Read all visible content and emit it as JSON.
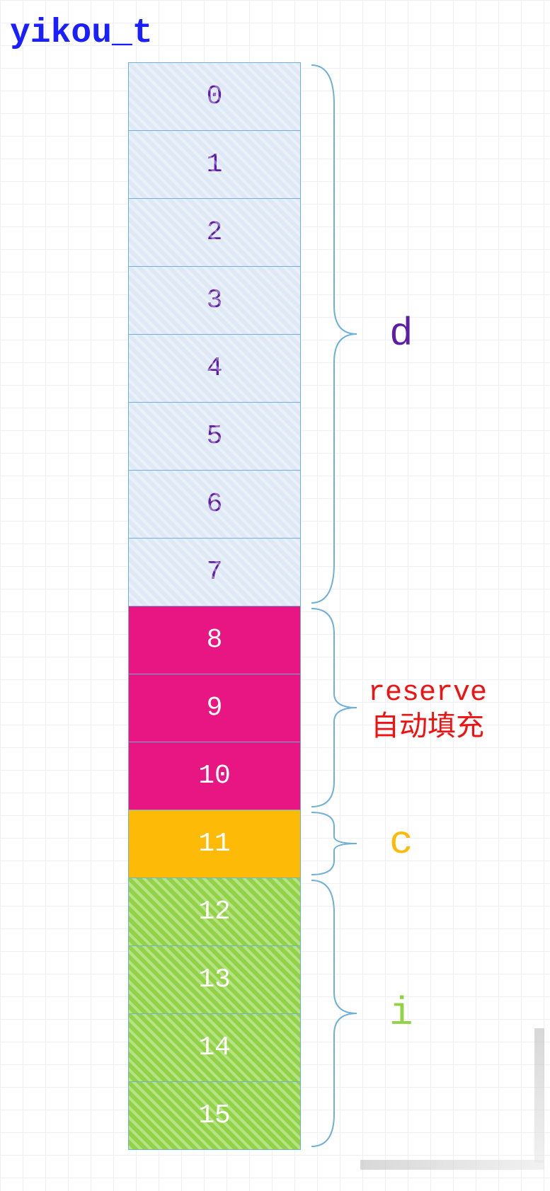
{
  "title": "yikou_t",
  "groups": [
    {
      "id": "d",
      "label": "d",
      "color": "#5d1ea5",
      "cells": [
        "0",
        "1",
        "2",
        "3",
        "4",
        "5",
        "6",
        "7"
      ]
    },
    {
      "id": "r",
      "label": "reserve\n自动填充",
      "color": "#f21010",
      "cells": [
        "8",
        "9",
        "10"
      ]
    },
    {
      "id": "c",
      "label": "c",
      "color": "#fdbb08",
      "cells": [
        "11"
      ]
    },
    {
      "id": "i",
      "label": "i",
      "color": "#92d246",
      "cells": [
        "12",
        "13",
        "14",
        "15"
      ]
    }
  ]
}
